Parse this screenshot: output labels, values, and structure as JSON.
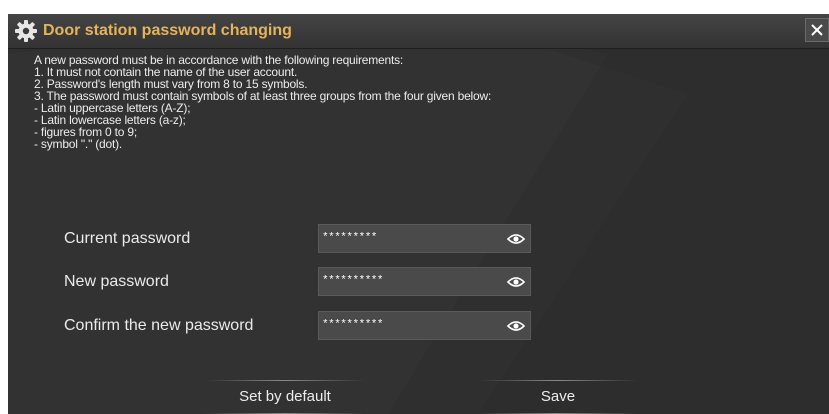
{
  "window": {
    "title": "Door station password changing",
    "title_icon": "gear-icon",
    "close_icon": "close-icon",
    "title_color": "#e4b45a",
    "background_color": "#2f2f2f"
  },
  "requirements": [
    "A new password must be in accordance with the following requirements:",
    "1. It must not contain the name of the user account.",
    "2. Password's length must vary from 8 to 15 symbols.",
    "3. The password must contain symbols of at least three groups from the four given below:",
    "- Latin uppercase letters (A-Z);",
    "- Latin lowercase letters (a-z);",
    "- figures from 0 to 9;",
    "- symbol \".\" (dot)."
  ],
  "fields": {
    "current": {
      "label": "Current password",
      "value": "*********",
      "icon": "eye-icon"
    },
    "new": {
      "label": "New password",
      "value": "**********",
      "icon": "eye-icon"
    },
    "confirm": {
      "label": "Confirm the new password",
      "value": "**********",
      "icon": "eye-icon"
    }
  },
  "buttons": {
    "set_default_label": "Set by default",
    "save_label": "Save"
  }
}
